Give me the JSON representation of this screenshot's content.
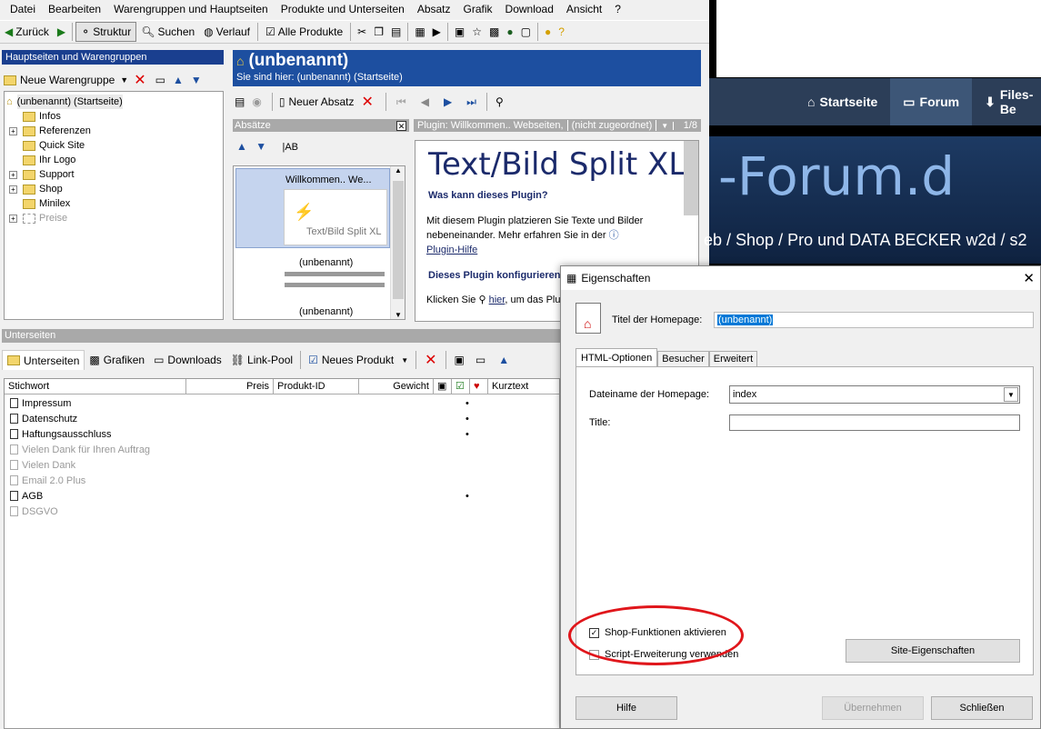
{
  "menu": [
    "Datei",
    "Bearbeiten",
    "Warengruppen und Hauptseiten",
    "Produkte und Unterseiten",
    "Absatz",
    "Grafik",
    "Download",
    "Ansicht",
    "?"
  ],
  "toolbar": {
    "back": "Zurück",
    "structure": "Struktur",
    "search": "Suchen",
    "history": "Verlauf",
    "all_products": "Alle Produkte"
  },
  "left_panel": {
    "title": "Hauptseiten und Warengruppen",
    "new_group": "Neue Warengruppe",
    "root": "(unbenannt) (Startseite)",
    "items": [
      "Infos",
      "Referenzen",
      "Quick Site",
      "Ihr Logo",
      "Support",
      "Shop",
      "Minilex",
      "Preise"
    ]
  },
  "page_header": {
    "title": "(unbenannt)",
    "breadcrumb": "Sie sind hier: (unbenannt) (Startseite)"
  },
  "absatz_toolbar": {
    "new": "Neuer Absatz"
  },
  "absaetze": {
    "title": "Absätze",
    "plugin_label": "Plugin: Willkommen.. Webseiten,",
    "not_assigned": "(nicht zugeordnet)",
    "pager": "1/8",
    "item1": "Willkommen.. We...",
    "item1_caption": "Text/Bild Split XL",
    "item2": "(unbenannt)",
    "item3": "(unbenannt)"
  },
  "preview": {
    "heading": "Text/Bild Split XL",
    "q": "Was kann dieses Plugin?",
    "body1": "Mit diesem Plugin platzieren Sie Texte und Bilder",
    "body2": "nebeneinander. Mehr erfahren Sie in der",
    "link": "Plugin-Hilfe",
    "q2": "Dieses Plugin konfigurieren",
    "click": "Klicken Sie",
    "here": "hier",
    "rest": ", um das Plu"
  },
  "browser": {
    "nav": [
      "Startseite",
      "Forum",
      "Files-Be"
    ],
    "banner": "-Forum.d",
    "sub": "eb / Shop / Pro und DATA BECKER w2d / s2"
  },
  "subpages": {
    "title": "Unterseiten",
    "tabs": [
      "Unterseiten",
      "Grafiken",
      "Downloads",
      "Link-Pool"
    ],
    "new_product": "Neues Produkt",
    "cols": [
      "Stichwort",
      "Preis",
      "Produkt-ID",
      "Gewicht",
      "Kurztext"
    ],
    "rows": [
      {
        "name": "Impressum",
        "gray": false,
        "dot": true
      },
      {
        "name": "Datenschutz",
        "gray": false,
        "dot": true
      },
      {
        "name": "Haftungsausschluss",
        "gray": false,
        "dot": true
      },
      {
        "name": "Vielen Dank für Ihren Auftrag",
        "gray": true,
        "dot": false
      },
      {
        "name": "Vielen Dank",
        "gray": true,
        "dot": false
      },
      {
        "name": "Email 2.0 Plus",
        "gray": true,
        "dot": false
      },
      {
        "name": "AGB",
        "gray": false,
        "dot": true
      },
      {
        "name": "DSGVO",
        "gray": true,
        "dot": false
      }
    ]
  },
  "dialog": {
    "title": "Eigenschaften",
    "homepage_label": "Titel der Homepage:",
    "homepage_value": "(unbenannt)",
    "tabs": [
      "HTML-Optionen",
      "Besucher",
      "Erweitert"
    ],
    "filename_label": "Dateiname der Homepage:",
    "filename_value": "index",
    "title_label": "Title:",
    "title_value": "",
    "shop_check": "Shop-Funktionen aktivieren",
    "script_check": "Script-Erweiterung verwenden",
    "site_props": "Site-Eigenschaften",
    "help": "Hilfe",
    "apply": "Übernehmen",
    "close": "Schließen"
  },
  "colors": {
    "accent": "#1d4fa0",
    "highlight": "#c5d4ee",
    "annotation": "#e0161b"
  }
}
